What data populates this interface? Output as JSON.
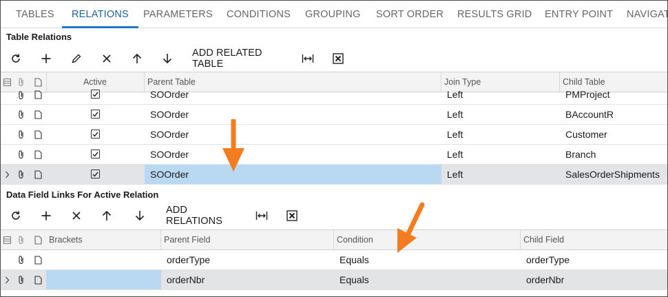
{
  "tabs": [
    {
      "label": "TABLES",
      "active": false
    },
    {
      "label": "RELATIONS",
      "active": true
    },
    {
      "label": "PARAMETERS",
      "active": false
    },
    {
      "label": "CONDITIONS",
      "active": false
    },
    {
      "label": "GROUPING",
      "active": false
    },
    {
      "label": "SORT ORDER",
      "active": false
    },
    {
      "label": "RESULTS GRID",
      "active": false
    },
    {
      "label": "ENTRY POINT",
      "active": false
    },
    {
      "label": "NAVIGATI",
      "active": false
    }
  ],
  "table_relations": {
    "title": "Table Relations",
    "toolbar": {
      "refresh_icon": "refresh-icon",
      "add_icon": "plus-icon",
      "edit_icon": "pencil-icon",
      "delete_icon": "close-icon",
      "up_icon": "arrow-up-icon",
      "down_icon": "arrow-down-icon",
      "add_related_table": "ADD RELATED TABLE",
      "fit_icon": "fit-columns-icon",
      "export_icon": "excel-export-icon"
    },
    "columns": {
      "active": "Active",
      "parent_table": "Parent Table",
      "join_type": "Join Type",
      "child_table": "Child Table"
    },
    "rows": [
      {
        "active": true,
        "parent_table": "SOOrder",
        "join_type": "Left",
        "child_table": "PMProject",
        "selected": false
      },
      {
        "active": true,
        "parent_table": "SOOrder",
        "join_type": "Left",
        "child_table": "BAccountR",
        "selected": false
      },
      {
        "active": true,
        "parent_table": "SOOrder",
        "join_type": "Left",
        "child_table": "Customer",
        "selected": false
      },
      {
        "active": true,
        "parent_table": "SOOrder",
        "join_type": "Left",
        "child_table": "Branch",
        "selected": false
      },
      {
        "active": true,
        "parent_table": "SOOrder",
        "join_type": "Left",
        "child_table": "SalesOrderShipments",
        "selected": true
      }
    ]
  },
  "data_field_links": {
    "title": "Data Field Links For Active Relation",
    "toolbar": {
      "refresh_icon": "refresh-icon",
      "add_icon": "plus-icon",
      "delete_icon": "close-icon",
      "up_icon": "arrow-up-icon",
      "down_icon": "arrow-down-icon",
      "add_relations": "ADD RELATIONS",
      "fit_icon": "fit-columns-icon",
      "export_icon": "excel-export-icon"
    },
    "columns": {
      "brackets": "Brackets",
      "parent_field": "Parent Field",
      "condition": "Condition",
      "child_field": "Child Field"
    },
    "rows": [
      {
        "brackets": "",
        "parent_field": "orderType",
        "condition": "Equals",
        "child_field": "orderType",
        "selected": false
      },
      {
        "brackets": "",
        "parent_field": "orderNbr",
        "condition": "Equals",
        "child_field": "orderNbr",
        "selected": true
      }
    ]
  },
  "annotation_color": "#f47c20"
}
